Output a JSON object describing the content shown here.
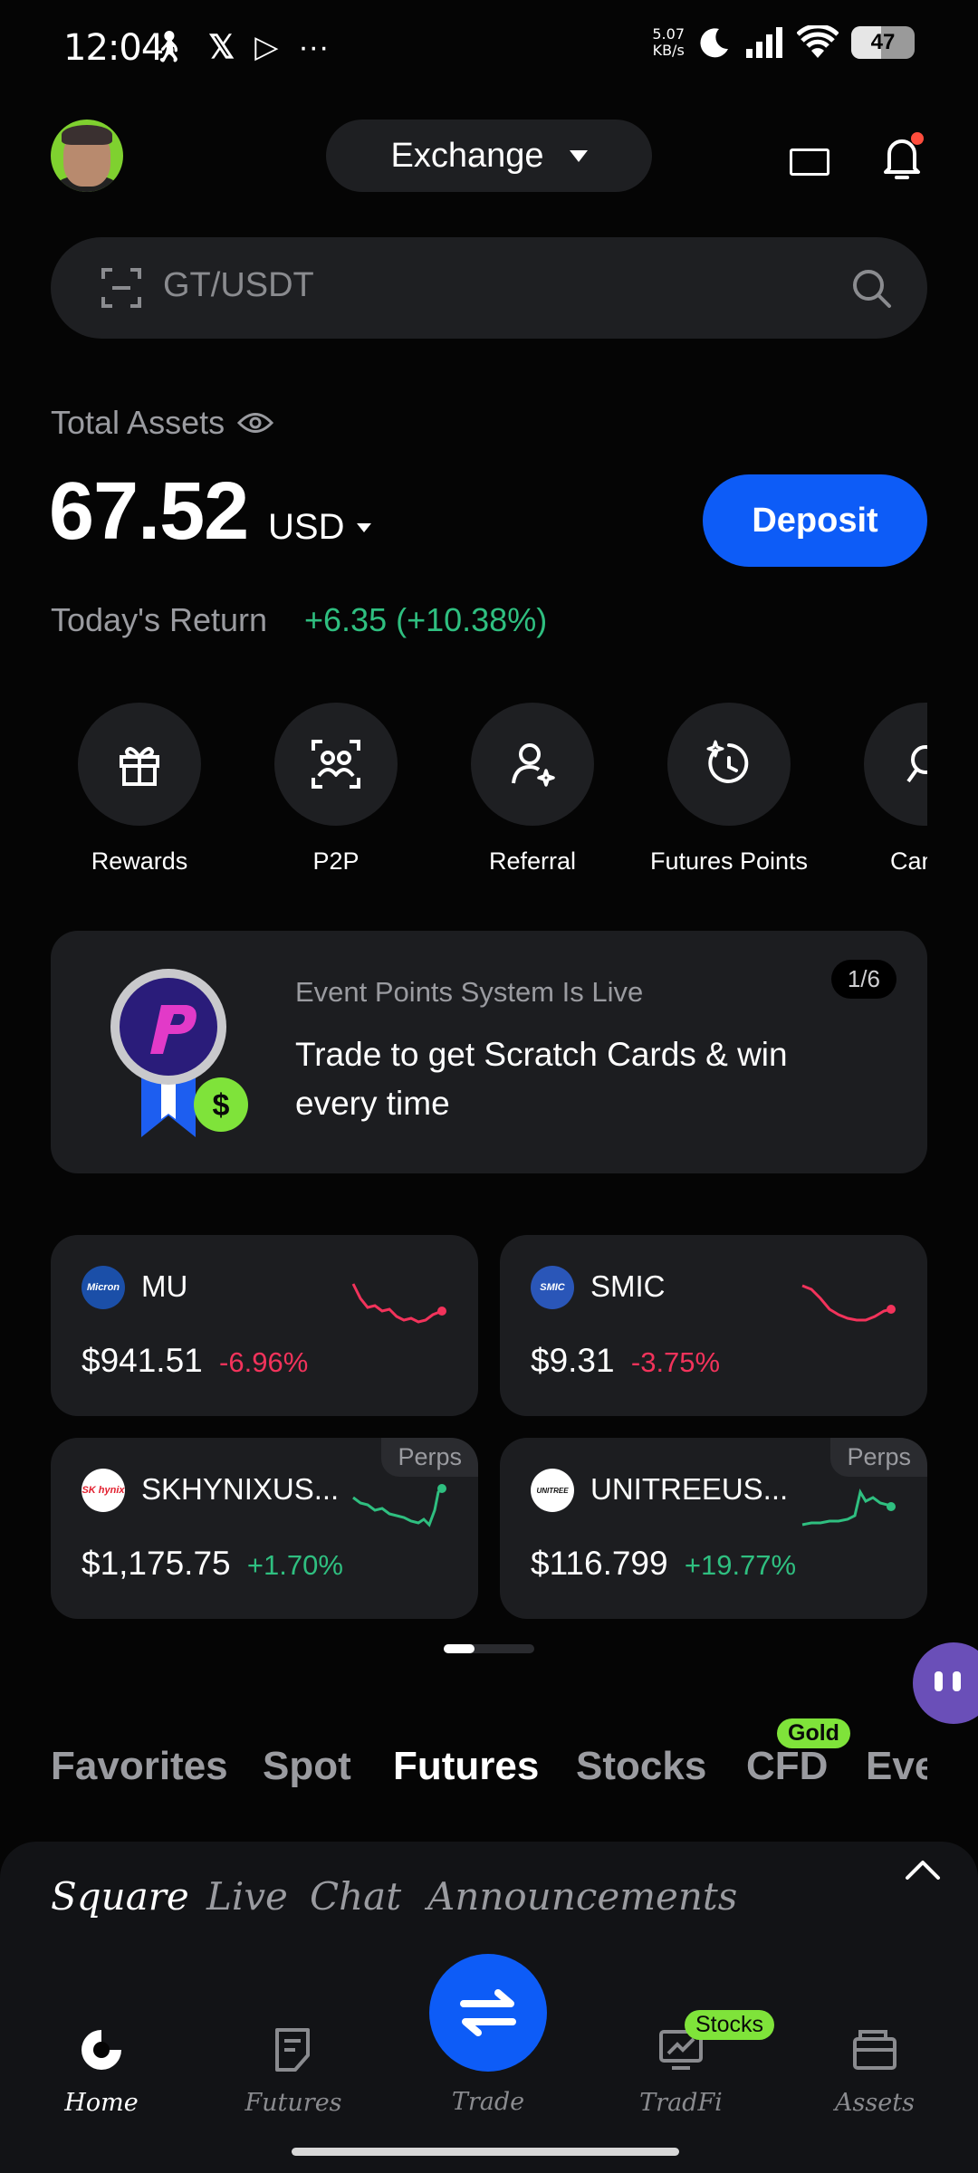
{
  "status_bar": {
    "time": "12:04",
    "net_speed_value": "5.07",
    "net_speed_unit": "KB/s",
    "battery": "47",
    "left_icons": [
      "walking-icon",
      "x-logo-icon",
      "play-icon",
      "more-icon"
    ],
    "right_icons": [
      "moon-icon",
      "signal-icon",
      "wifi-icon",
      "battery-icon"
    ]
  },
  "header": {
    "exchange_label": "Exchange",
    "icons": [
      "avatar",
      "screen-icon",
      "bell-icon"
    ]
  },
  "search": {
    "placeholder": "GT/USDT"
  },
  "assets": {
    "label": "Total Assets",
    "value": "67.52",
    "unit": "USD",
    "deposit_label": "Deposit",
    "today_return_label": "Today's Return",
    "today_return_value": "+6.35 (+10.38%)"
  },
  "quick_actions": [
    {
      "label": "Rewards",
      "icon": "gift-icon"
    },
    {
      "label": "P2P",
      "icon": "p2p-icon"
    },
    {
      "label": "Referral",
      "icon": "referral-icon"
    },
    {
      "label": "Futures Points",
      "icon": "futures-points-icon"
    },
    {
      "label": "Candy",
      "icon": "candy-icon"
    }
  ],
  "banner": {
    "subtitle": "Event Points System Is Live",
    "title": "Trade to get Scratch Cards & win every time",
    "page": "1/6"
  },
  "tickers": [
    {
      "symbol": "MU",
      "logo_text": "Micron",
      "price": "$941.51",
      "change": "-6.96%",
      "trend": "down",
      "tag": ""
    },
    {
      "symbol": "SMIC",
      "logo_text": "SMIC",
      "price": "$9.31",
      "change": "-3.75%",
      "trend": "down",
      "tag": ""
    },
    {
      "symbol": "SKHYNIXUS...",
      "logo_text": "SK hynix",
      "price": "$1,175.75",
      "change": "+1.70%",
      "trend": "up",
      "tag": "Perps"
    },
    {
      "symbol": "UNITREEUS...",
      "logo_text": "UNITREE",
      "price": "$116.799",
      "change": "+19.77%",
      "trend": "up",
      "tag": "Perps"
    }
  ],
  "market_tabs": {
    "items": [
      "Favorites",
      "Spot",
      "Futures",
      "Stocks",
      "CFD",
      "Eve"
    ],
    "active": "Futures",
    "badge": "Gold"
  },
  "feed_tabs": {
    "items": [
      "Square",
      "Live",
      "Chat",
      "Announcements"
    ],
    "active": "Square"
  },
  "bottom_nav": {
    "items": [
      "Home",
      "Futures",
      "Trade",
      "TradFi",
      "Assets"
    ],
    "active": "Home",
    "badge": "Stocks"
  },
  "colors": {
    "accent": "#0d5cf7",
    "positive": "#2fbf80",
    "negative": "#f2335b",
    "badge": "#7fe33a"
  }
}
